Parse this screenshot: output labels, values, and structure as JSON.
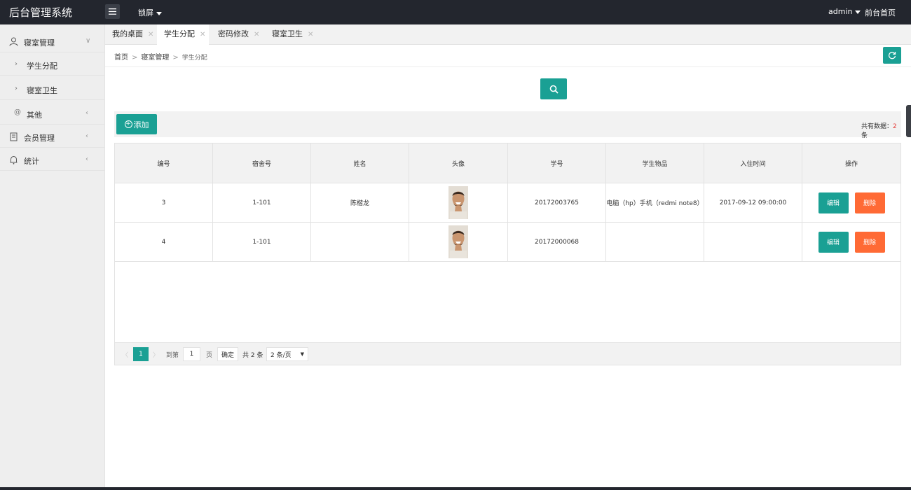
{
  "header": {
    "logo": "后台管理系统",
    "lock": "锁屏",
    "user": "admin",
    "front": "前台首页"
  },
  "sidebar": {
    "items": [
      {
        "label": "寝室管理",
        "icon": "user-icon"
      },
      {
        "label": "学生分配"
      },
      {
        "label": "寝室卫生"
      },
      {
        "label": "其他",
        "icon": "at-icon"
      },
      {
        "label": "会员管理",
        "icon": "document-icon"
      },
      {
        "label": "统计",
        "icon": "bell-icon"
      }
    ]
  },
  "tabs": [
    "我的桌面",
    "学生分配",
    "密码修改",
    "寝室卫生"
  ],
  "breadcrumb": {
    "home": "首页",
    "section": "寝室管理",
    "current": "学生分配",
    "separator": ">"
  },
  "toolbar": {
    "add_label": "添加",
    "total_label": "共有数据：",
    "total_count": "2",
    "total_unit": "条"
  },
  "table": {
    "headers": [
      "编号",
      "宿舍号",
      "姓名",
      "头像",
      "学号",
      "学生物品",
      "入住时间",
      "操作"
    ],
    "rows": [
      {
        "id": "3",
        "dorm": "1-101",
        "name": "陈楷龙",
        "student_no": "20172003765",
        "items": "电脑（hp）手机（redmi note8）",
        "checkin": "2017-09-12 09:00:00",
        "edit": "编辑",
        "delete": "删除"
      },
      {
        "id": "4",
        "dorm": "1-101",
        "name": "",
        "student_no": "20172000068",
        "items": "",
        "checkin": "",
        "edit": "编辑",
        "delete": "删除"
      }
    ]
  },
  "pagination": {
    "prev": "〈",
    "current": "1",
    "next": "〉",
    "goto_label": "到第",
    "goto_value": "1",
    "page_unit": "页",
    "confirm": "确定",
    "total": "共 2 条",
    "page_size": "2 条/页"
  },
  "colors": {
    "accent": "#1aa094",
    "danger": "#ff6a35",
    "header_bg": "#23262e"
  }
}
